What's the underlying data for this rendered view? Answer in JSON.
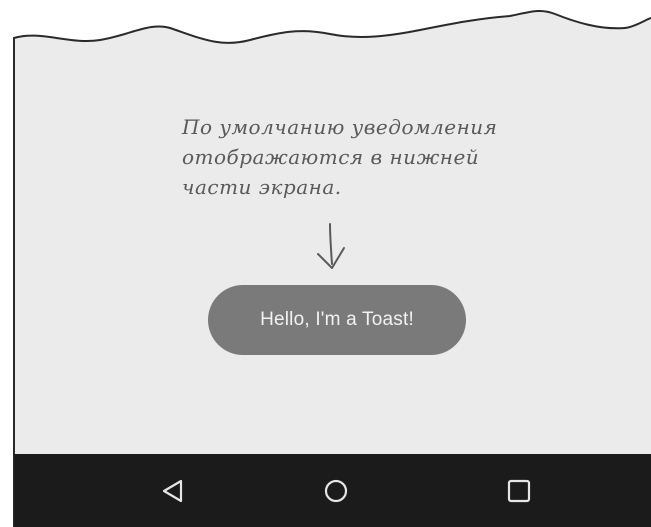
{
  "annotation": {
    "lines": [
      "По умолчанию уведомления",
      "отображаются в нижней",
      "части экрана."
    ]
  },
  "toast": {
    "message": "Hello, I'm a Toast!"
  },
  "colors": {
    "screen_background": "#ebebeb",
    "toast_background": "#7a7a7a",
    "toast_text": "#f2f2f2",
    "nav_bar": "#1b1b1b",
    "nav_icons": "#e6e6e6",
    "handwriting": "#5a5a5a"
  },
  "navigation": {
    "buttons": [
      {
        "icon": "back-triangle-icon"
      },
      {
        "icon": "home-circle-icon"
      },
      {
        "icon": "recents-square-icon"
      }
    ]
  }
}
